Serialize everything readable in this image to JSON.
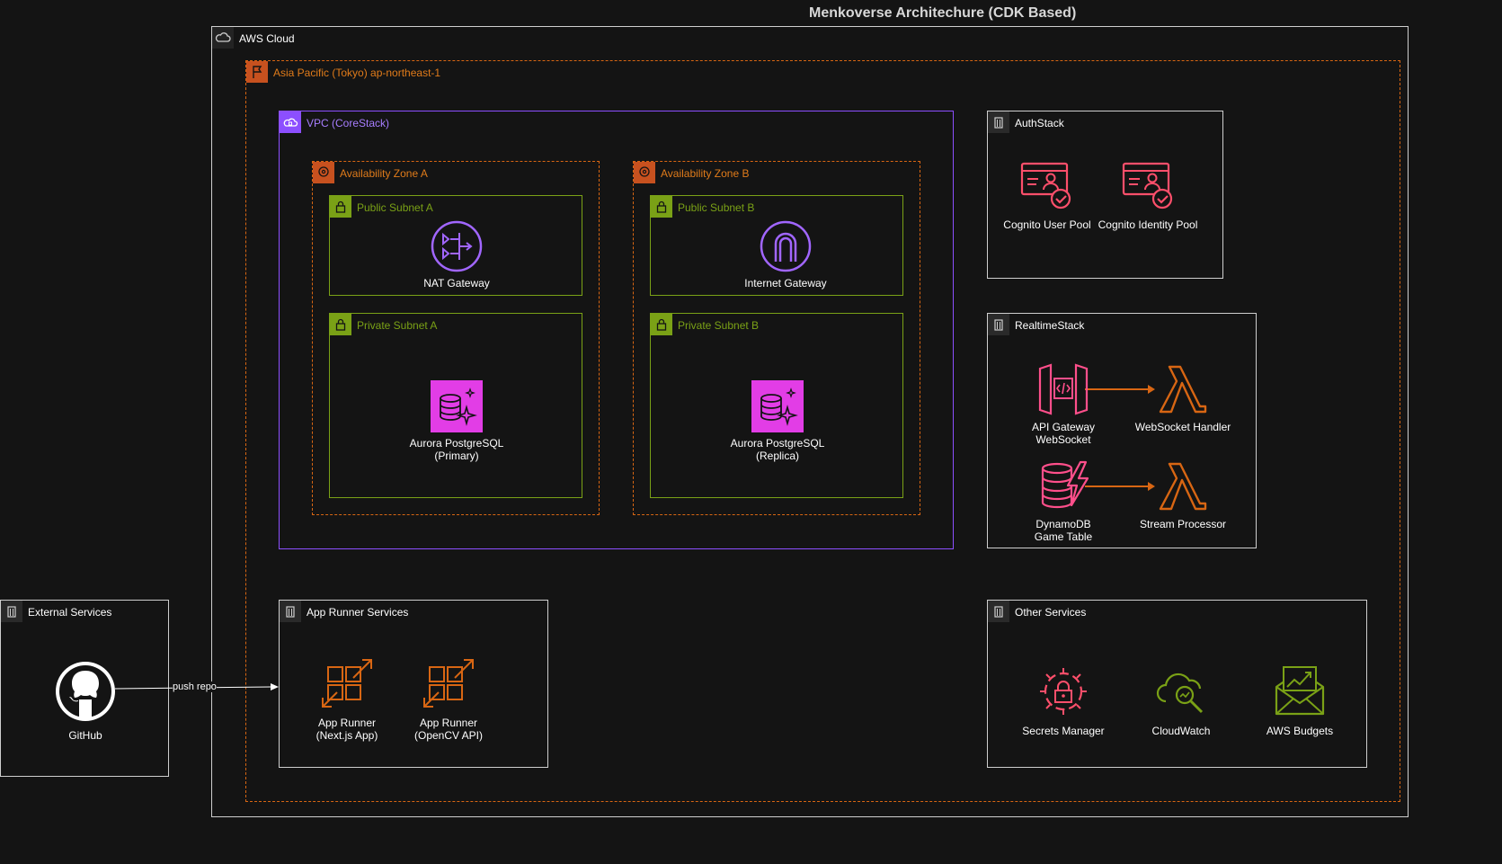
{
  "title": "Menkoverse Architechure (CDK Based)",
  "colors": {
    "background": "#141414",
    "aws_cloud_border": "#cfcfcf",
    "region_border": "#d86613",
    "vpc": "#8c4fff",
    "subnet": "#7aa116",
    "compute_orange": "#d86613",
    "security_red": "#dd344c",
    "database_pink": "#c925d1",
    "monitoring_green": "#7aa116"
  },
  "groups": {
    "aws_cloud": "AWS Cloud",
    "region": "Asia Pacific (Tokyo) ap-northeast-1",
    "vpc": "VPC (CoreStack)",
    "az_a": "Availability Zone A",
    "az_b": "Availability Zone B",
    "public_subnet_a": "Public Subnet A",
    "public_subnet_b": "Public Subnet B",
    "private_subnet_a": "Private Subnet A",
    "private_subnet_b": "Private Subnet B",
    "auth_stack": "AuthStack",
    "realtime_stack": "RealtimeStack",
    "external_services": "External Services",
    "app_runner_services": "App Runner Services",
    "other_services": "Other Services"
  },
  "nodes": {
    "nat_gateway": "NAT Gateway",
    "internet_gateway": "Internet Gateway",
    "aurora_primary": "Aurora PostgreSQL\n(Primary)",
    "aurora_replica": "Aurora PostgreSQL\n(Replica)",
    "cognito_user_pool": "Cognito User Pool",
    "cognito_identity_pool": "Cognito Identity Pool",
    "api_gateway_ws": "API Gateway\nWebSocket",
    "websocket_handler": "WebSocket Handler",
    "dynamodb_table": "DynamoDB\nGame Table",
    "stream_processor": "Stream Processor",
    "github": "GitHub",
    "app_runner_next": "App Runner\n(Next.js App)",
    "app_runner_opencv": "App Runner\n(OpenCV API)",
    "secrets_manager": "Secrets Manager",
    "cloudwatch": "CloudWatch",
    "aws_budgets": "AWS Budgets"
  },
  "edges": {
    "push_repo": "push repo"
  },
  "icons": {
    "cloud": "cloud-icon",
    "region": "flag-icon",
    "vpc": "vpc-cloud-icon",
    "az": "location-pin-icon",
    "subnet": "lock-icon",
    "stack": "building-icon",
    "nat": "nat-gateway-icon",
    "igw": "internet-gateway-icon",
    "aurora": "aurora-icon",
    "cognito": "cognito-icon",
    "apigw": "api-gateway-icon",
    "lambda": "lambda-icon",
    "dynamodb": "dynamodb-icon",
    "github": "github-icon",
    "apprunner": "app-runner-icon",
    "secrets": "secrets-manager-icon",
    "cloudwatch": "cloudwatch-icon",
    "budgets": "budgets-icon"
  }
}
